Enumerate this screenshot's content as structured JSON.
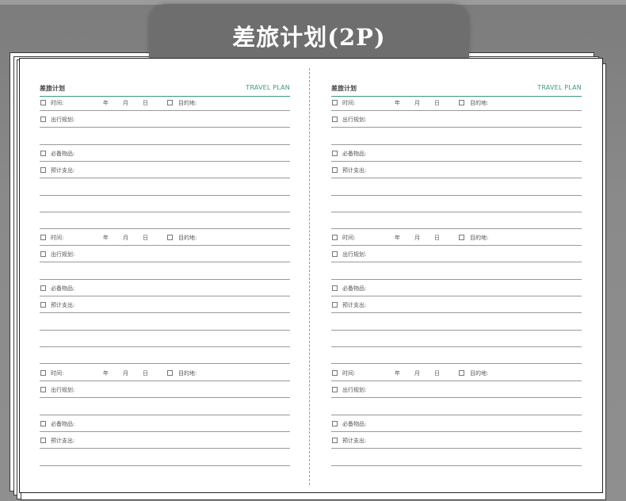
{
  "banner": {
    "title": "差旅计划(2P)"
  },
  "header": {
    "cn": "差旅计划",
    "en": "TRAVEL PLAN"
  },
  "labels": {
    "time": "时间:",
    "year": "年",
    "month": "月",
    "day": "日",
    "destination": "目的地:",
    "itinerary": "出行规划:",
    "essentials": "必备物品:",
    "budget": "预计支出:"
  },
  "pages": [
    "left",
    "right"
  ],
  "blocks_per_page": 3,
  "colors": {
    "accent": "#3d9a80",
    "line": "#9a9a9a",
    "banner": "#6e6e6e"
  }
}
